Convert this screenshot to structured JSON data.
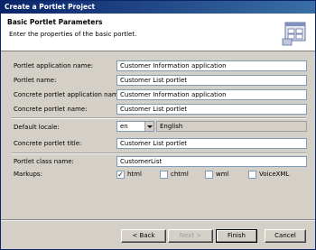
{
  "window": {
    "title": "Create a Portlet Project"
  },
  "header": {
    "title": "Basic Portlet Parameters",
    "subtitle": "Enter the properties of the basic portlet.",
    "icon": "portlet-wizard-icon"
  },
  "form": {
    "portlet_app_name": {
      "label": "Portlet application name:",
      "value": "Customer Information application"
    },
    "portlet_name": {
      "label": "Portlet name:",
      "value": "Customer List portlet"
    },
    "concrete_app_name": {
      "label": "Concrete portlet application name:",
      "value": "Customer Information application"
    },
    "concrete_portlet_name": {
      "label": "Concrete portlet name:",
      "value": "Customer List portlet"
    },
    "default_locale": {
      "label": "Default locale:",
      "value": "en",
      "display": "English"
    },
    "concrete_title": {
      "label": "Concrete portlet title:",
      "value": "Customer List portlet"
    },
    "class_name": {
      "label": "Portlet class name:",
      "value": "CustomerList"
    },
    "markups": {
      "label": "Markups:",
      "options": [
        {
          "label": "html",
          "checked": true
        },
        {
          "label": "chtml",
          "checked": false
        },
        {
          "label": "wml",
          "checked": false
        },
        {
          "label": "VoiceXML",
          "checked": false
        }
      ]
    }
  },
  "buttons": {
    "back": "< Back",
    "next": "Next >",
    "finish": "Finish",
    "cancel": "Cancel"
  },
  "colors": {
    "title_bar": "#0a246a",
    "dialog_bg": "#d4d0c8"
  }
}
